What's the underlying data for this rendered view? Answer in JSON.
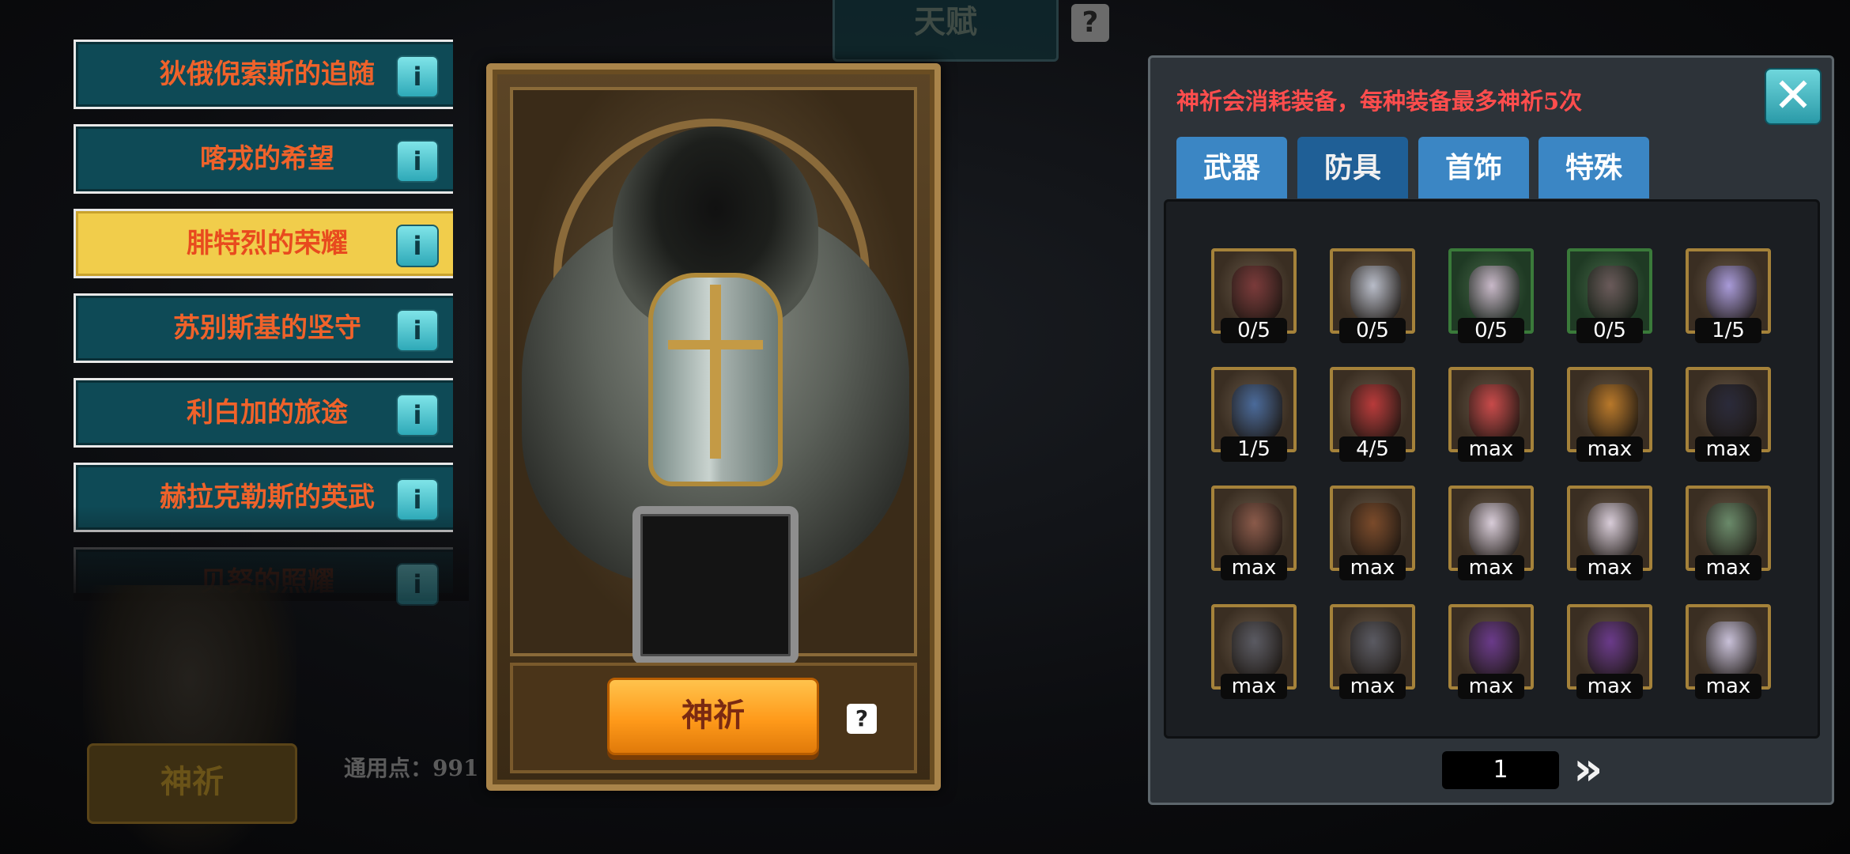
{
  "top": {
    "title": "天赋",
    "help_glyph": "?"
  },
  "left_list": {
    "items": [
      {
        "label": "狄俄倪索斯的追随"
      },
      {
        "label": "喀戎的希望"
      },
      {
        "label": "腓特烈的荣耀",
        "active": true
      },
      {
        "label": "苏别斯基的坚守"
      },
      {
        "label": "利白加的旅途"
      },
      {
        "label": "赫拉克勒斯的英武"
      },
      {
        "label": "贝努的照耀"
      }
    ],
    "info_glyph": "i"
  },
  "bottom_left": {
    "pray_label": "神祈",
    "points_text": "通用点：991"
  },
  "card": {
    "pray_label": "神祈",
    "help_glyph": "?"
  },
  "panel": {
    "note": "神祈会消耗装备，每种装备最多神祈5次",
    "close_glyph": "✕",
    "tabs": [
      {
        "label": "武器"
      },
      {
        "label": "防具",
        "active": true
      },
      {
        "label": "首饰"
      },
      {
        "label": "特殊"
      }
    ],
    "items": [
      {
        "count": "0/5",
        "frame": "gold",
        "tint": "#7a3a3a",
        "icon": "gauntlet-icon"
      },
      {
        "count": "0/5",
        "frame": "gold",
        "tint": "#b8bcc8",
        "icon": "helmet-icon"
      },
      {
        "count": "0/5",
        "frame": "green",
        "tint": "#c8b8c8",
        "icon": "armor-icon"
      },
      {
        "count": "0/5",
        "frame": "green",
        "tint": "#6a5a5a",
        "icon": "boots-icon"
      },
      {
        "count": "1/5",
        "frame": "gold",
        "tint": "#a89ad8",
        "icon": "armor-icon"
      },
      {
        "count": "1/5",
        "frame": "gold",
        "tint": "#4a6a9a",
        "icon": "armor-icon"
      },
      {
        "count": "4/5",
        "frame": "gold",
        "tint": "#b83a3a",
        "icon": "armor-icon"
      },
      {
        "count": "max",
        "frame": "gold",
        "tint": "#c84a4a",
        "icon": "gauntlet-icon"
      },
      {
        "count": "max",
        "frame": "gold",
        "tint": "#b8782a",
        "icon": "gauntlet-icon"
      },
      {
        "count": "max",
        "frame": "gold",
        "tint": "#2a2a3a",
        "icon": "hood-icon"
      },
      {
        "count": "max",
        "frame": "gold",
        "tint": "#8a5a4a",
        "icon": "armor-icon"
      },
      {
        "count": "max",
        "frame": "gold",
        "tint": "#7a4a2a",
        "icon": "boots-icon"
      },
      {
        "count": "max",
        "frame": "gold",
        "tint": "#d8ccd8",
        "icon": "boots-icon"
      },
      {
        "count": "max",
        "frame": "gold",
        "tint": "#d8ccd8",
        "icon": "boots-icon"
      },
      {
        "count": "max",
        "frame": "gold",
        "tint": "#6a8a6a",
        "icon": "gauntlet-icon"
      },
      {
        "count": "max",
        "frame": "gold",
        "tint": "#5a5a62",
        "icon": "gauntlet-icon"
      },
      {
        "count": "max",
        "frame": "gold",
        "tint": "#5a5a62",
        "icon": "gauntlet-icon"
      },
      {
        "count": "max",
        "frame": "gold",
        "tint": "#6a3a8a",
        "icon": "boots-icon"
      },
      {
        "count": "max",
        "frame": "gold",
        "tint": "#6a3a8a",
        "icon": "boots-icon"
      },
      {
        "count": "max",
        "frame": "gold",
        "tint": "#c8c0d8",
        "icon": "helmet-icon"
      }
    ],
    "page": "1",
    "next_glyph": "»"
  }
}
